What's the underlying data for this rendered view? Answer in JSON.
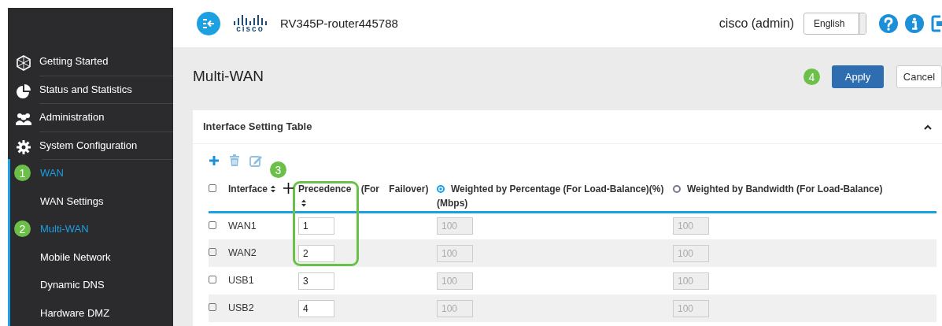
{
  "header": {
    "logo_text": "cisco",
    "hostname": "RV345P-router445788",
    "user": "cisco (admin)",
    "language": "English"
  },
  "sidebar": {
    "items": [
      {
        "label": "Getting Started",
        "kind": "section",
        "selected": false
      },
      {
        "label": "Status and Statistics",
        "kind": "section",
        "selected": false
      },
      {
        "label": "Administration",
        "kind": "section",
        "selected": false
      },
      {
        "label": "System Configuration",
        "kind": "section",
        "selected": false
      },
      {
        "label": "WAN",
        "kind": "group",
        "selected": true,
        "callout": "1",
        "children": [
          {
            "label": "WAN Settings",
            "selected": false
          },
          {
            "label": "Multi-WAN",
            "selected": true,
            "callout": "2"
          },
          {
            "label": "Mobile Network",
            "selected": false
          },
          {
            "label": "Dynamic DNS",
            "selected": false
          },
          {
            "label": "Hardware DMZ",
            "selected": false
          }
        ]
      }
    ]
  },
  "page": {
    "title": "Multi-WAN",
    "buttons": [
      {
        "label": "Apply",
        "kind": "primary",
        "callout": "4"
      },
      {
        "label": "Cancel",
        "kind": "secondary"
      }
    ]
  },
  "card": {
    "title": "Interface Setting Table",
    "expanded": true
  },
  "table": {
    "select_all_checked": false,
    "columns": [
      {
        "label": "Interface",
        "sortable": true
      },
      {
        "label": "Precedence (For Failover)",
        "sortable": true,
        "callout": "3",
        "highlighted": true
      }
    ],
    "weight_modes": [
      {
        "label": "Weighted by Percentage (For Load-Balance)(%)",
        "selected": true
      },
      {
        "label": "Weighted by Bandwidth (For Load-Balance)",
        "selected": false
      }
    ],
    "weight_unit": "(Mbps)",
    "rows": [
      {
        "checked": false,
        "interface": "WAN1",
        "precedence": "1",
        "percentage": "100",
        "bandwidth": "100",
        "weights_disabled": true
      },
      {
        "checked": false,
        "interface": "WAN2",
        "precedence": "2",
        "percentage": "100",
        "bandwidth": "100",
        "weights_disabled": true
      },
      {
        "checked": false,
        "interface": "USB1",
        "precedence": "3",
        "percentage": "100",
        "bandwidth": "100",
        "weights_disabled": true
      },
      {
        "checked": false,
        "interface": "USB2",
        "precedence": "4",
        "percentage": "100",
        "bandwidth": "100",
        "weights_disabled": true
      }
    ]
  }
}
